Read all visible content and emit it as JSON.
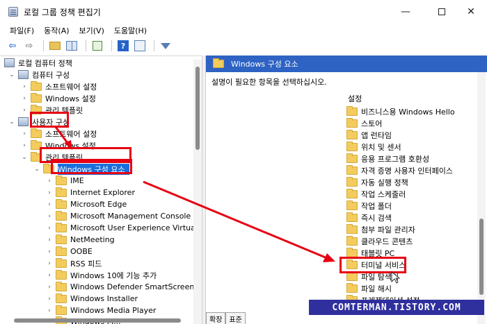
{
  "window": {
    "title": "로컬 그룹 정책 편집기",
    "minimize": "—",
    "close": "✕"
  },
  "menu": [
    "파일(F)",
    "동작(A)",
    "보기(V)",
    "도움말(H)"
  ],
  "toolbar": {
    "back": "⇦",
    "forward": "⇨",
    "help": "?"
  },
  "tree": {
    "root": "로컬 컴퓨터 정책",
    "computer": "컴퓨터 구성",
    "computer_children": [
      "소프트웨어 설정",
      "Windows 설정",
      "관리 템플릿"
    ],
    "user": "사용자 구성",
    "user_children": [
      "소프트웨어 설정",
      "Windows 설정",
      "관리 템플릿"
    ],
    "selected": "Windows 구성 요소",
    "components": [
      "IME",
      "Internet Explorer",
      "Microsoft Edge",
      "Microsoft Management Console",
      "Microsoft User Experience Virtualiza",
      "NetMeeting",
      "OOBE",
      "RSS 피드",
      "Windows 10에 기능 추가",
      "Windows Defender SmartScreen",
      "Windows Installer",
      "Windows Media Player",
      "Windows M..."
    ],
    "expanders": {
      "collapsed": "›",
      "expanded": "⌄"
    }
  },
  "right": {
    "header": "Windows 구성 요소",
    "description": "설명이 필요한 항목을 선택하십시오.",
    "column": "설정",
    "items": [
      "비즈니스용 Windows Hello",
      "스토어",
      "앱 런타임",
      "위치 및 센서",
      "응용 프로그램 호환성",
      "자격 증명 사용자 인터페이스",
      "자동 실행 정책",
      "작업 스케줄러",
      "작업 폴더",
      "즉시 검색",
      "첨부 파일 관리자",
      "클라우드 콘텐츠",
      "태블릿 PC",
      "터미널 서비스",
      "파일 탐색기",
      "파일 해시",
      "프레젠테이션 설정"
    ],
    "tabs": [
      "확장",
      "표준"
    ]
  },
  "watermark": "COMTERMAN.TISTORY.COM",
  "colors": {
    "highlight": "#e60012",
    "selection": "#1a6fdc",
    "header": "#2e63c3"
  }
}
